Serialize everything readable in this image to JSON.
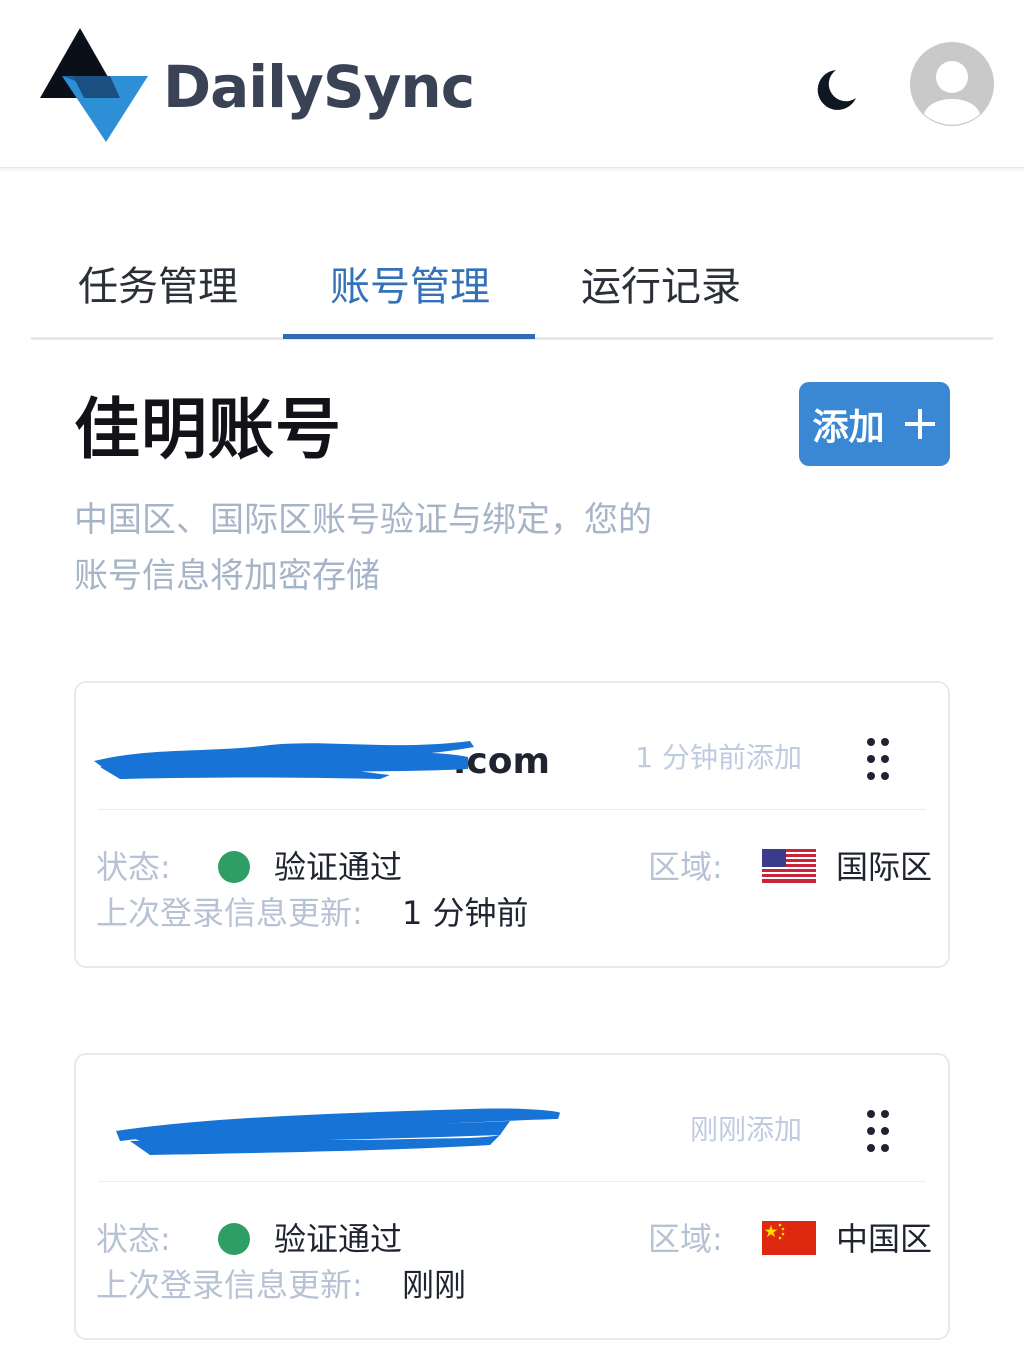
{
  "app": {
    "brand": "DailySync"
  },
  "colors": {
    "accent": "#3a88d4",
    "tab_active": "#3371b8",
    "status_ok": "#2f9e64"
  },
  "icons": {
    "theme": "moon-icon",
    "profile": "avatar-icon",
    "add": "plus-icon",
    "card_menu": "grid-dots-icon"
  },
  "tabs": [
    {
      "label": "任务管理",
      "active": false
    },
    {
      "label": "账号管理",
      "active": true
    },
    {
      "label": "运行记录",
      "active": false
    }
  ],
  "page": {
    "title": "佳明账号",
    "add_label": "添加",
    "description_line1": "中国区、国际区账号验证与绑定，您的",
    "description_line2": "账号信息将加密存储"
  },
  "accounts": [
    {
      "email_visible": ".com",
      "added": "1 分钟前添加",
      "status_label": "状态:",
      "status_value": "验证通过",
      "region_label": "区域:",
      "region_value": "国际区",
      "region_flag": "us-flag-icon",
      "last_update_label": "上次登录信息更新:",
      "last_update_value": "1 分钟前"
    },
    {
      "email_visible": "",
      "added": "刚刚添加",
      "status_label": "状态:",
      "status_value": "验证通过",
      "region_label": "区域:",
      "region_value": "中国区",
      "region_flag": "cn-flag-icon",
      "last_update_label": "上次登录信息更新:",
      "last_update_value": "刚刚"
    }
  ]
}
